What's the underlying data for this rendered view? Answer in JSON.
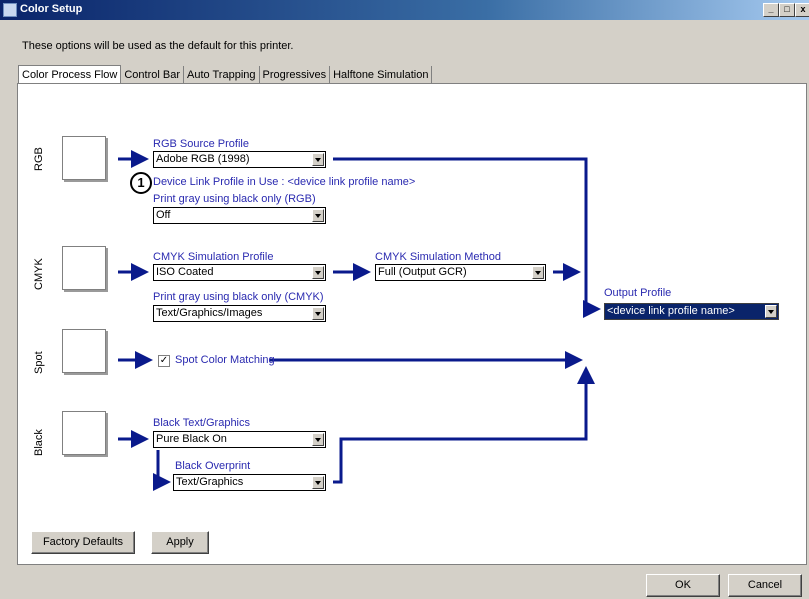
{
  "window": {
    "title": "Color Setup",
    "min_label": "_",
    "max_label": "□",
    "close_label": "x"
  },
  "description": "These options will be used as the default for this printer.",
  "tabs": [
    "Color Process Flow",
    "Control Bar",
    "Auto Trapping",
    "Progressives",
    "Halftone Simulation"
  ],
  "rows": {
    "rgb": {
      "side_label": "RGB",
      "source_label": "RGB Source Profile",
      "source_value": "Adobe RGB (1998)",
      "badge": "1",
      "device_link_text": "Device Link Profile in Use : <device link profile name>",
      "gray_label": "Print gray using black only (RGB)",
      "gray_value": "Off"
    },
    "cmyk": {
      "side_label": "CMYK",
      "sim_label": "CMYK Simulation Profile",
      "sim_value": "ISO Coated",
      "method_label": "CMYK Simulation Method",
      "method_value": "Full (Output GCR)",
      "gray_label": "Print gray using black only (CMYK)",
      "gray_value": "Text/Graphics/Images"
    },
    "spot": {
      "side_label": "Spot",
      "check_label": "Spot Color Matching",
      "checked": true
    },
    "black": {
      "side_label": "Black",
      "text_label": "Black Text/Graphics",
      "text_value": "Pure Black On",
      "overprint_label": "Black Overprint",
      "overprint_value": "Text/Graphics"
    }
  },
  "output": {
    "label": "Output Profile",
    "value": "<device link profile name>"
  },
  "buttons": {
    "factory_defaults": "Factory Defaults",
    "apply": "Apply",
    "ok": "OK",
    "cancel": "Cancel"
  },
  "colors": {
    "flow_line": "#0a1a8c",
    "label_blue": "#2a2ab0",
    "title_bar": "#0a246a"
  }
}
